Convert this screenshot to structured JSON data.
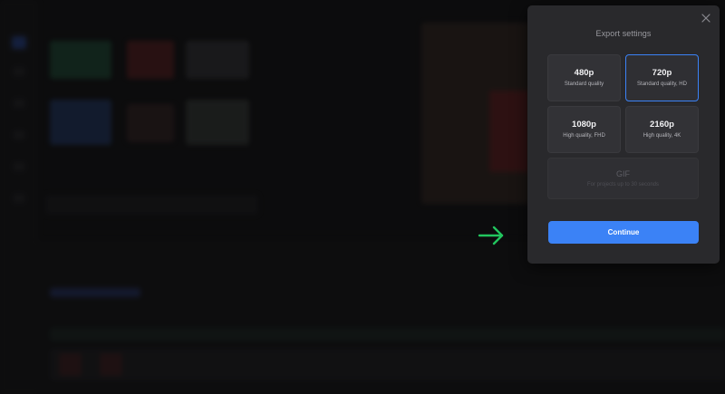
{
  "modal": {
    "title": "Export settings",
    "close_icon": "close-icon",
    "options": [
      {
        "resolution": "480p",
        "quality": "Standard quality",
        "selected": false
      },
      {
        "resolution": "720p",
        "quality": "Standard quality, HD",
        "selected": true
      },
      {
        "resolution": "1080p",
        "quality": "High quality, FHD",
        "selected": false
      },
      {
        "resolution": "2160p",
        "quality": "High quality, 4K",
        "selected": false
      },
      {
        "resolution": "GIF",
        "quality": "For projects up to 30 seconds",
        "selected": false,
        "disabled": true
      }
    ],
    "continue_label": "Continue"
  },
  "annotation": {
    "arrow_icon": "arrow-right-icon",
    "arrow_color": "#22c55e"
  },
  "colors": {
    "accent": "#3b82f6",
    "modal_bg": "#29292c",
    "page_bg": "#0d0d0f"
  }
}
